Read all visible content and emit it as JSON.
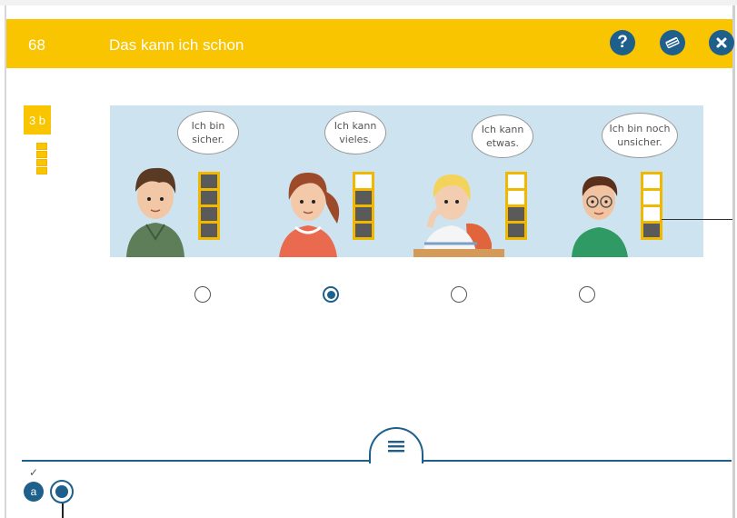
{
  "header": {
    "page_number": "68",
    "title": "Das kann ich schon",
    "help_icon": "question-mark-icon",
    "book_icon": "book-icon",
    "close_icon": "close-icon",
    "bar_color": "#f9c400",
    "button_color": "#1f5f8b"
  },
  "task": {
    "badge": "3 b"
  },
  "illustration": {
    "characters": [
      {
        "speech": "Ich bin\nsicher.",
        "filled_levels": 4,
        "total_levels": 4
      },
      {
        "speech": "Ich kann\nvieles.",
        "filled_levels": 3,
        "total_levels": 4
      },
      {
        "speech": "Ich kann\netwas.",
        "filled_levels": 2,
        "total_levels": 4
      },
      {
        "speech": "Ich bin noch\nunsicher.",
        "filled_levels": 1,
        "total_levels": 4
      }
    ]
  },
  "options": {
    "selected_index": 1,
    "count": 4
  },
  "bottom_nav": {
    "menu_icon": "hamburger-menu-icon",
    "done_item_label": "a",
    "done_icon": "checkmark-icon"
  }
}
